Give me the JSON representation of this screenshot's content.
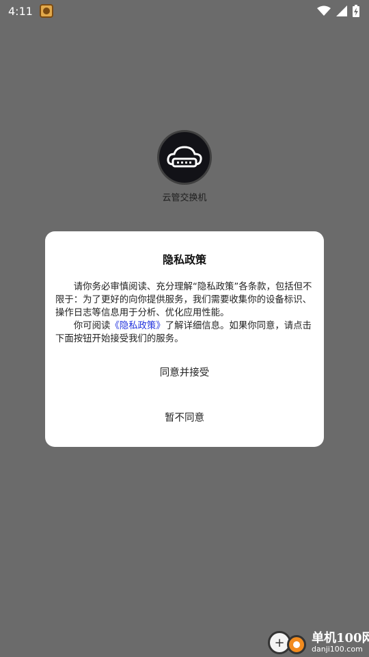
{
  "status_bar": {
    "time": "4:11",
    "notification_icon": "app-notification-icon",
    "wifi_icon": "wifi-icon",
    "signal_icon": "signal-icon",
    "battery_icon": "battery-charging-icon"
  },
  "app": {
    "name": "云管交换机",
    "logo_icon": "cloud-switch-icon"
  },
  "dialog": {
    "title": "隐私政策",
    "paragraph1": "请你务必审慎阅读、充分理解“隐私政策”各条款，包括但不限于：为了更好的向你提供服务，我们需要收集你的设备标识、操作日志等信息用于分析、优化应用性能。",
    "paragraph2_prefix": "你可阅读",
    "paragraph2_link": "《隐私政策》",
    "paragraph2_suffix": "了解详细信息。如果你同意，请点击下面按钮开始接受我们的服务。",
    "agree_label": "同意并接受",
    "disagree_label": "暂不同意"
  },
  "watermark": {
    "name": "单机100网",
    "url": "danji100.com"
  },
  "colors": {
    "overlay": "#6b6b6b",
    "link": "#2233dd",
    "dialog_bg": "#ffffff"
  }
}
